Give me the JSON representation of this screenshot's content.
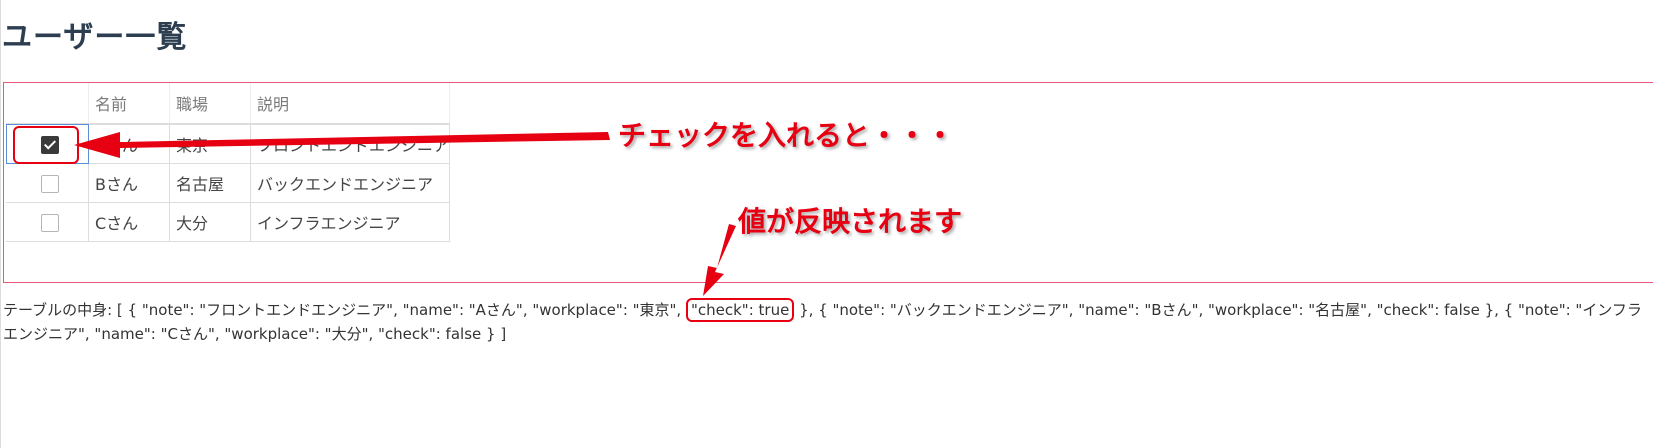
{
  "page": {
    "title": "ユーザー一覧"
  },
  "table": {
    "headers": [
      "名前",
      "職場",
      "説明"
    ],
    "rows": [
      {
        "name": "Aさん",
        "workplace": "東京",
        "note": "フロントエンドエンジニア",
        "check": true
      },
      {
        "name": "Bさん",
        "workplace": "名古屋",
        "note": "バックエンドエンジニア",
        "check": false
      },
      {
        "name": "Cさん",
        "workplace": "大分",
        "note": "インフラエンジニア",
        "check": false
      }
    ]
  },
  "dump": {
    "prefix": "テーブルの中身: [ { \"note\": \"フロントエンドエンジニア\", \"name\": \"Aさん\", \"workplace\": \"東京\", ",
    "highlight": "\"check\": true",
    "suffix": " }, { \"note\": \"バックエンドエンジニア\", \"name\": \"Bさん\", \"workplace\": \"名古屋\", \"check\": false }, { \"note\": \"インフラエンジニア\", \"name\": \"Cさん\", \"workplace\": \"大分\", \"check\": false } ]"
  },
  "annotations": {
    "check_caption": "チェックを入れると・・・",
    "reflect_caption": "値が反映されます",
    "color": "#e60012"
  }
}
